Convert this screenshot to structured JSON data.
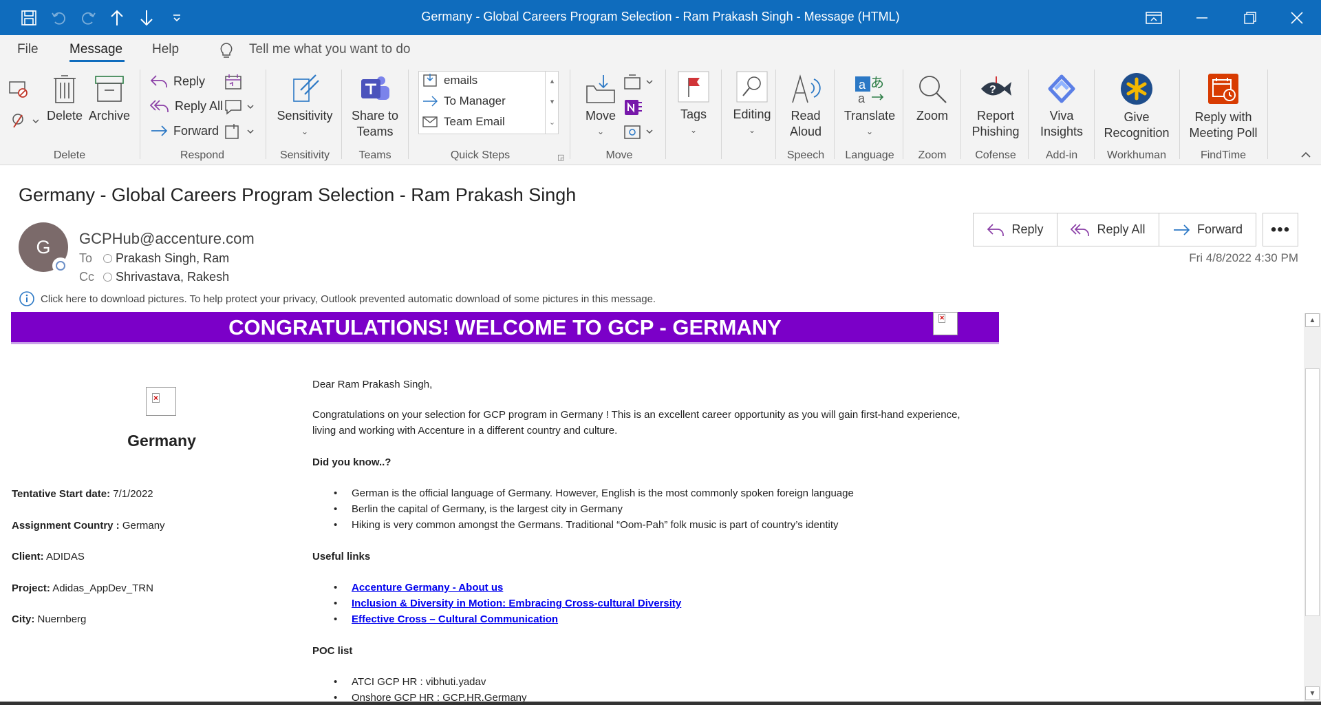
{
  "window": {
    "title": "Germany - Global Careers Program Selection - Ram Prakash Singh  -  Message (HTML)"
  },
  "menu": {
    "tabs": [
      "File",
      "Message",
      "Help"
    ],
    "search_placeholder": "Tell me what you want to do"
  },
  "ribbon": {
    "delete_label": "Delete",
    "archive_label": "Archive",
    "reply_label": "Reply",
    "reply_all_label": "Reply All",
    "forward_label": "Forward",
    "sensitivity_label": "Sensitivity",
    "share_teams_label_1": "Share to",
    "share_teams_label_2": "Teams",
    "quick_steps": [
      "emails",
      "To Manager",
      "Team Email"
    ],
    "move_label": "Move",
    "tags_label": "Tags",
    "editing_label": "Editing",
    "read_aloud_1": "Read",
    "read_aloud_2": "Aloud",
    "translate_label": "Translate",
    "zoom_label": "Zoom",
    "report_phishing_1": "Report",
    "report_phishing_2": "Phishing",
    "viva_1": "Viva",
    "viva_2": "Insights",
    "give_1": "Give",
    "give_2": "Recognition",
    "meeting_poll_1": "Reply with",
    "meeting_poll_2": "Meeting Poll",
    "groups": {
      "delete": "Delete",
      "respond": "Respond",
      "sensitivity": "Sensitivity",
      "teams": "Teams",
      "quick_steps": "Quick Steps",
      "move": "Move",
      "speech": "Speech",
      "language": "Language",
      "zoom": "Zoom",
      "cofense": "Cofense",
      "addin": "Add-in",
      "workhuman": "Workhuman",
      "findtime": "FindTime"
    }
  },
  "message": {
    "subject": "Germany - Global Careers Program Selection - Ram Prakash Singh",
    "avatar_initial": "G",
    "from": "GCPHub@accenture.com",
    "to_label": "To",
    "to": "Prakash Singh, Ram",
    "cc_label": "Cc",
    "cc": "Shrivastava, Rakesh",
    "date": "Fri 4/8/2022 4:30 PM",
    "reply_label": "Reply",
    "reply_all_label": "Reply All",
    "forward_label": "Forward",
    "info_bar": "Click here to download pictures. To help protect your privacy, Outlook prevented automatic download of some pictures in this message."
  },
  "body": {
    "banner": "CONGRATULATIONS! WELCOME TO GCP - GERMANY",
    "country_heading": "Germany",
    "details": [
      {
        "label": "Tentative Start date:",
        "value": " 7/1/2022"
      },
      {
        "label": "Assignment Country :",
        "value": " Germany"
      },
      {
        "label": "Client:",
        "value": " ADIDAS"
      },
      {
        "label": "Project:",
        "value": " Adidas_AppDev_TRN"
      },
      {
        "label": "City:",
        "value": " Nuernberg"
      }
    ],
    "greeting": "Dear Ram Prakash Singh,",
    "intro_line1": "Congratulations on your selection for GCP program in Germany ! This is an excellent career opportunity as you will gain first-hand experience,",
    "intro_line2": "living and working with Accenture in a different country and culture.",
    "did_you_know": "Did you know..?",
    "facts": [
      "German is the official language of Germany. However, English is the most commonly spoken foreign language",
      "Berlin the capital of Germany, is the largest city in Germany",
      "Hiking is very common amongst the Germans. Traditional “Oom-Pah” folk music is part of country’s identity"
    ],
    "useful_links": "Useful links",
    "links": [
      "Accenture Germany - About us",
      "Inclusion & Diversity in Motion: Embracing Cross-cultural Diversity",
      "Effective Cross – Cultural Communication"
    ],
    "poc_list": "POC list",
    "pocs": [
      "ATCI GCP HR : vibhuti.yadav",
      "Onshore GCP HR : GCP.HR.Germany"
    ]
  },
  "colors": {
    "titlebar": "#0f6cbd",
    "banner": "#7b00c8",
    "link": "#0000ee"
  }
}
